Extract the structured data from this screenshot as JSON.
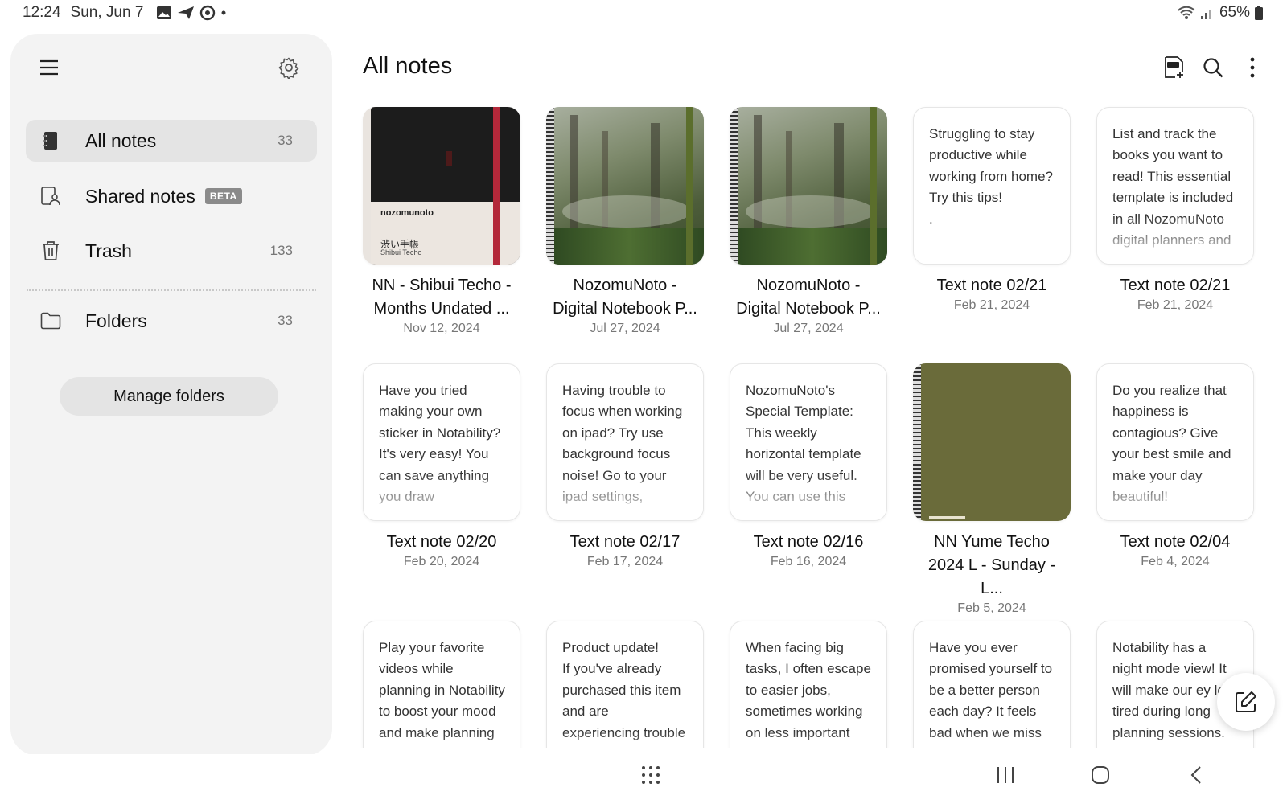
{
  "status_bar": {
    "time": "12:24",
    "date": "Sun, Jun 7",
    "battery": "65%"
  },
  "sidebar": {
    "items": [
      {
        "label": "All notes",
        "count": "33",
        "icon": "notebook-icon"
      },
      {
        "label": "Shared notes",
        "badge": "BETA",
        "icon": "shared-notes-icon"
      },
      {
        "label": "Trash",
        "count": "133",
        "icon": "trash-icon"
      },
      {
        "label": "Folders",
        "count": "33",
        "icon": "folder-icon"
      }
    ],
    "manage_label": "Manage folders"
  },
  "main": {
    "title": "All notes"
  },
  "notes": [
    {
      "title": "NN - Shibui Techo - Months Undated ...",
      "date": "Nov 12, 2024",
      "type": "cover-black"
    },
    {
      "title": "NozomuNoto - Digital Notebook P...",
      "date": "Jul 27, 2024",
      "type": "cover-forest"
    },
    {
      "title": "NozomuNoto - Digital Notebook P...",
      "date": "Jul 27, 2024",
      "type": "cover-forest"
    },
    {
      "title": "Text note 02/21",
      "date": "Feb 21, 2024",
      "preview": "Struggling to stay productive while working from home?\nTry this tips!\n."
    },
    {
      "title": "Text note 02/21",
      "date": "Feb 21, 2024",
      "preview": "List and track the books you want to read! This essential template is included in all NozomuNoto digital planners and"
    },
    {
      "title": "Text note 02/20",
      "date": "Feb 20, 2024",
      "preview": "Have you tried making your own sticker in Notability? It's very easy! You can save anything you draw"
    },
    {
      "title": "Text note 02/17",
      "date": "Feb 17, 2024",
      "preview": "Having trouble to focus when working on ipad? Try use background focus noise! Go to your ipad settings,"
    },
    {
      "title": "Text note 02/16",
      "date": "Feb 16, 2024",
      "preview": "NozomuNoto's Special Template: This weekly horizontal template will be very useful. You can use this"
    },
    {
      "title": "NN Yume Techo 2024 L - Sunday - L...",
      "date": "Feb 5, 2024",
      "type": "cover-olive"
    },
    {
      "title": "Text note 02/04",
      "date": "Feb 4, 2024",
      "preview": "Do you realize that happiness is contagious? Give your best smile and make your day beautiful!"
    },
    {
      "preview": "Play your favorite videos while planning in Notability to boost your mood and make planning"
    },
    {
      "preview": "Product update!\nIf you've already purchased this item and are experiencing trouble"
    },
    {
      "preview": "When facing big tasks, I often escape to easier jobs, sometimes working on less important things just to feel"
    },
    {
      "preview": "Have you ever promised yourself to be a better person each day? It feels bad when we miss that goal"
    },
    {
      "preview": "Notability has a night mode view! It will make our ey less tired during long planning sessions. Give it a"
    }
  ],
  "cover": {
    "brand": "nozomunoto",
    "subtitle": "渋い手帳",
    "caption": "Shibui Techo"
  },
  "colors": {
    "sidebar_bg": "#f3f3f3",
    "active_item": "#e4e4e4",
    "olive_cover": "#6a6b3a",
    "black_cover": "#1c1c1c",
    "ribbon": "#b3283a"
  }
}
